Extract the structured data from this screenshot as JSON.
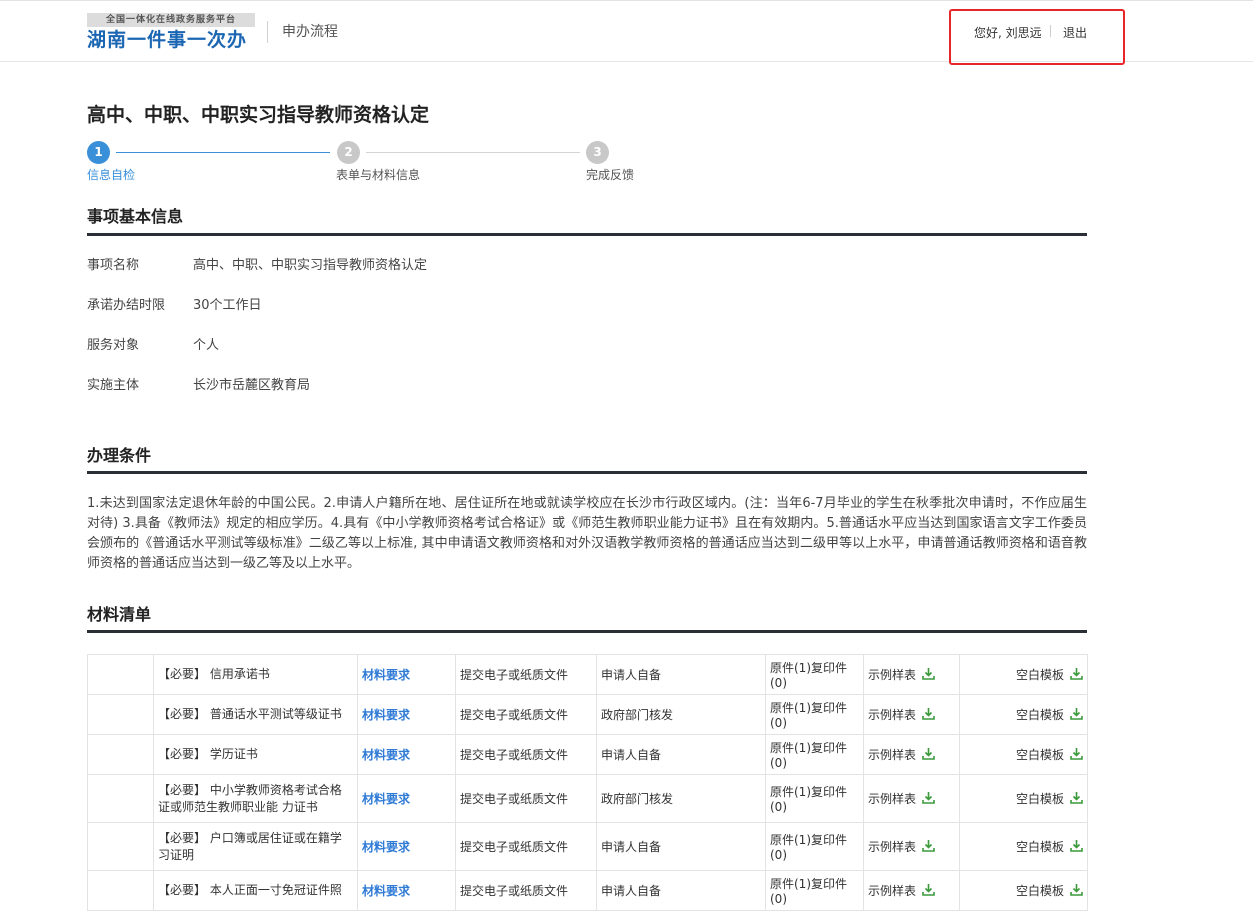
{
  "header": {
    "logo_top": "全国一体化在线政务服务平台",
    "logo_main": "湖南一件事一次办",
    "title": "申办流程",
    "greeting": "您好, 刘思远",
    "logout": "退出"
  },
  "page_title": "高中、中职、中职实习指导教师资格认定",
  "steps": [
    {
      "num": "1",
      "label": "信息自检",
      "active": true
    },
    {
      "num": "2",
      "label": "表单与材料信息",
      "active": false
    },
    {
      "num": "3",
      "label": "完成反馈",
      "active": false
    }
  ],
  "basic_info": {
    "title": "事项基本信息",
    "rows": [
      {
        "label": "事项名称",
        "value": "高中、中职、中职实习指导教师资格认定"
      },
      {
        "label": "承诺办结时限",
        "value": "30个工作日"
      },
      {
        "label": "服务对象",
        "value": "个人"
      },
      {
        "label": "实施主体",
        "value": "长沙市岳麓区教育局"
      }
    ]
  },
  "conditions": {
    "title": "办理条件",
    "text": "1.未达到国家法定退休年龄的中国公民。2.申请人户籍所在地、居住证所在地或就读学校应在长沙市行政区域内。(注：当年6-7月毕业的学生在秋季批次申请时，不作应届生对待) 3.具备《教师法》规定的相应学历。4.具有《中小学教师资格考试合格证》或《师范生教师职业能力证书》且在有效期内。5.普通话水平应当达到国家语言文字工作委员会颁布的《普通话水平测试等级标准》二级乙等以上标准, 其中申请语文教师资格和对外汉语教学教师资格的普通话应当达到二级甲等以上水平，申请普通话教师资格和语音教师资格的普通话应当达到一级乙等及以上水平。"
  },
  "materials": {
    "title": "材料清单",
    "rows": [
      {
        "name": "【必要】 信用承诺书",
        "req": "材料要求",
        "submit": "提交电子或纸质文件",
        "source": "申请人自备",
        "copies": "原件(1)复印件(0)",
        "sample": "示例样表",
        "blank": "空白模板"
      },
      {
        "name": "【必要】 普通话水平测试等级证书",
        "req": "材料要求",
        "submit": "提交电子或纸质文件",
        "source": "政府部门核发",
        "copies": "原件(1)复印件(0)",
        "sample": "示例样表",
        "blank": "空白模板"
      },
      {
        "name": "【必要】 学历证书",
        "req": "材料要求",
        "submit": "提交电子或纸质文件",
        "source": "申请人自备",
        "copies": "原件(1)复印件(0)",
        "sample": "示例样表",
        "blank": "空白模板"
      },
      {
        "name": "【必要】 中小学教师资格考试合格证或师范生教师职业能 力证书",
        "req": "材料要求",
        "submit": "提交电子或纸质文件",
        "source": "政府部门核发",
        "copies": "原件(1)复印件(0)",
        "sample": "示例样表",
        "blank": "空白模板"
      },
      {
        "name": "【必要】 户口簿或居住证或在籍学习证明",
        "req": "材料要求",
        "submit": "提交电子或纸质文件",
        "source": "申请人自备",
        "copies": "原件(1)复印件(0)",
        "sample": "示例样表",
        "blank": "空白模板"
      },
      {
        "name": "【必要】 本人正面一寸免冠证件照",
        "req": "材料要求",
        "submit": "提交电子或纸质文件",
        "source": "申请人自备",
        "copies": "原件(1)复印件(0)",
        "sample": "示例样表",
        "blank": "空白模板"
      }
    ]
  },
  "colors": {
    "accent": "#3a8fd9",
    "step_inactive": "#c8c8c8",
    "link": "#2f7bd6",
    "highlight_box": "#e8262a",
    "download_icon": "#3a9a3a"
  },
  "icons": {
    "download": "download-icon"
  }
}
